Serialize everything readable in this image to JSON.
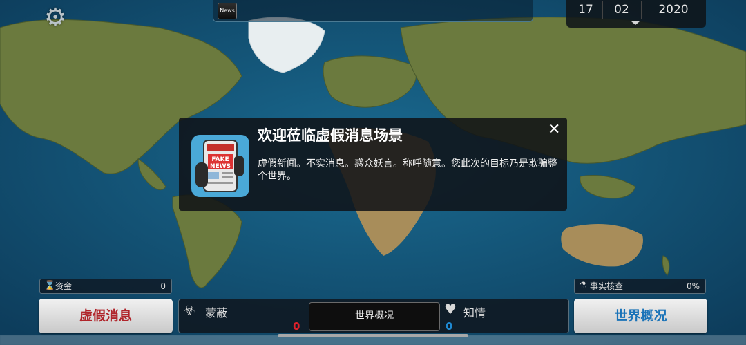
{
  "top": {
    "news_label": "News",
    "date": {
      "day": "17",
      "month": "02",
      "year": "2020"
    }
  },
  "dialog": {
    "title": "欢迎莅临虚假消息场景",
    "body": "虚假新闻。不实消息。惑众妖言。称呼随意。您此次的目标乃是欺骗整个世界。",
    "icon_text": "FAKE NEWS"
  },
  "bottom": {
    "funds": {
      "label": "资金",
      "value": "0"
    },
    "fact_check": {
      "label": "事实核查",
      "value": "0%"
    },
    "left_button": "虚假消息",
    "right_button": "世界概况",
    "stealth": {
      "label": "蒙蔽",
      "value": "0"
    },
    "awareness": {
      "label": "知情",
      "value": "0"
    },
    "center_button": "世界概况"
  },
  "colors": {
    "left_button_text": "#b0242a",
    "right_button_text": "#1a73b8",
    "stealth_value": "#e0202a",
    "awareness_value": "#1e88d0"
  }
}
